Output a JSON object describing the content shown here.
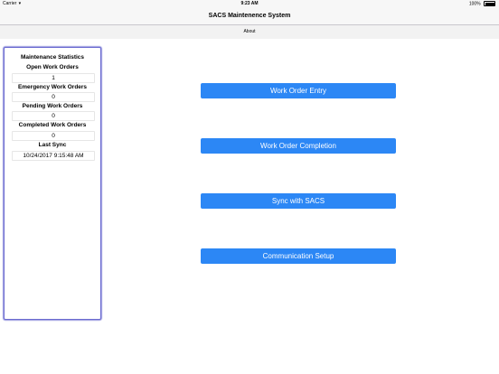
{
  "status_bar": {
    "carrier": "Carrier",
    "wifi_glyph": "▾",
    "time": "9:23 AM",
    "battery": "100%"
  },
  "nav": {
    "title": "SACS Maintenence System"
  },
  "toolbar": {
    "about_label": "About"
  },
  "stats": {
    "title": "Maintenance Statistics",
    "open_label": "Open Work Orders",
    "open_value": "1",
    "emergency_label": "Emergency Work Orders",
    "emergency_value": "0",
    "pending_label": "Pending Work Orders",
    "pending_value": "0",
    "completed_label": "Completed Work Orders",
    "completed_value": "0",
    "last_sync_label": "Last Sync",
    "last_sync_value": "10/24/2017 9:15:48 AM"
  },
  "actions": {
    "work_order_entry": "Work Order Entry",
    "work_order_completion": "Work Order Completion",
    "sync": "Sync with SACS",
    "communication_setup": "Communication Setup"
  },
  "colors": {
    "button": "#2c87f5",
    "panel_border": "#6a6ad0"
  }
}
